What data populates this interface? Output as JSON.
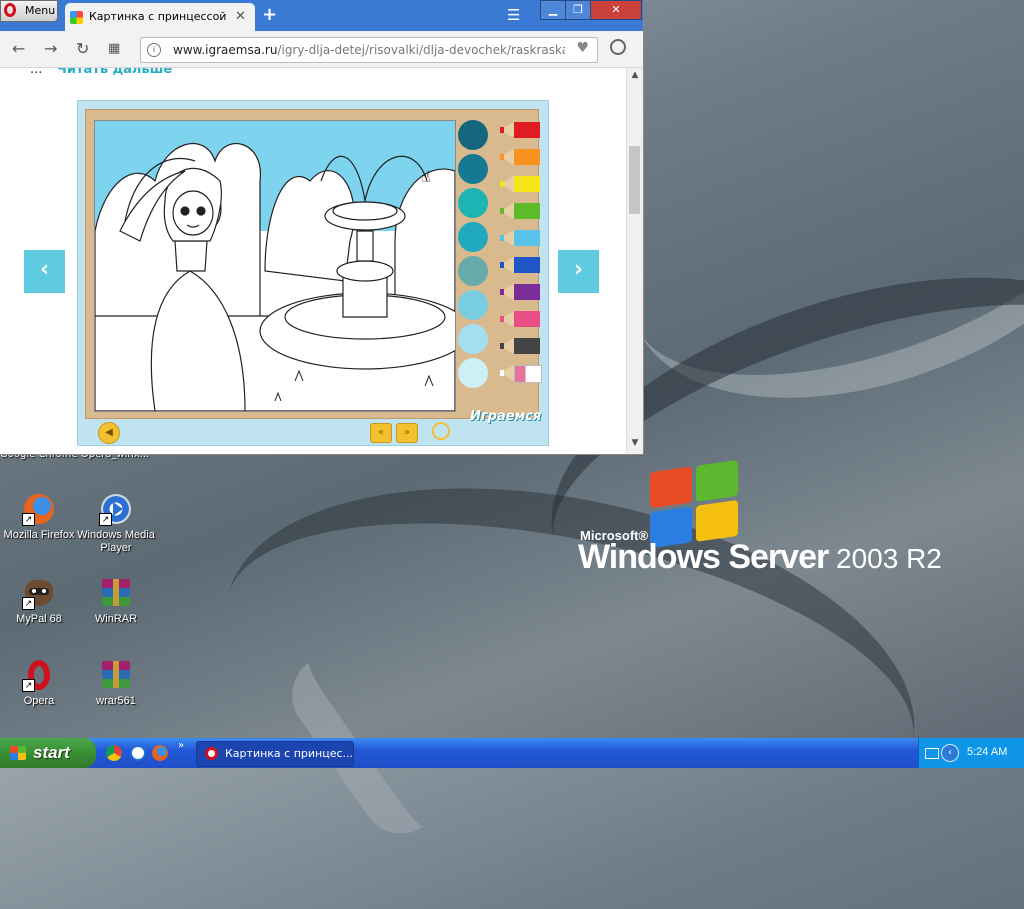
{
  "browser": {
    "menu_label": "Menu",
    "tab_title": "Картинка с принцессой для",
    "new_tab": "+",
    "url_host": "www.igraemsa.ru",
    "url_path": "/igry-dlja-detej/risovalki/dlja-devochek/raskraska-princ",
    "cut_text": "...",
    "read_more": "Читать дальше"
  },
  "game": {
    "prev": "‹",
    "next": "›",
    "brand": "Играемся",
    "palette_colors": [
      "#14667c",
      "#157991",
      "#1cb5b3",
      "#21a9c0",
      "#67abab",
      "#79cde0",
      "#a3dff0",
      "#cdeff6"
    ],
    "pencil_colors": [
      "#e11b22",
      "#f7931e",
      "#f7e51b",
      "#5dbb29",
      "#59c2e9",
      "#1f56c6",
      "#7b2d9a",
      "#e74f86",
      "#444444",
      "#ffffff"
    ]
  },
  "desktop": {
    "strip_text": "Google Chrome  Opera_winx...",
    "icons": [
      {
        "label": "Mozilla Firefox"
      },
      {
        "label": "Windows Media Player"
      },
      {
        "label": "MyPal 68"
      },
      {
        "label": "WinRAR"
      },
      {
        "label": "Opera"
      },
      {
        "label": "wrar561"
      }
    ],
    "logo_microsoft": "Microsoft®",
    "logo_windows": "Windows Server",
    "logo_version": "2003 R2"
  },
  "taskbar": {
    "start_label": "start",
    "more": "»",
    "task_title": "Картинка с принцес...",
    "clock": "5:24 AM"
  }
}
